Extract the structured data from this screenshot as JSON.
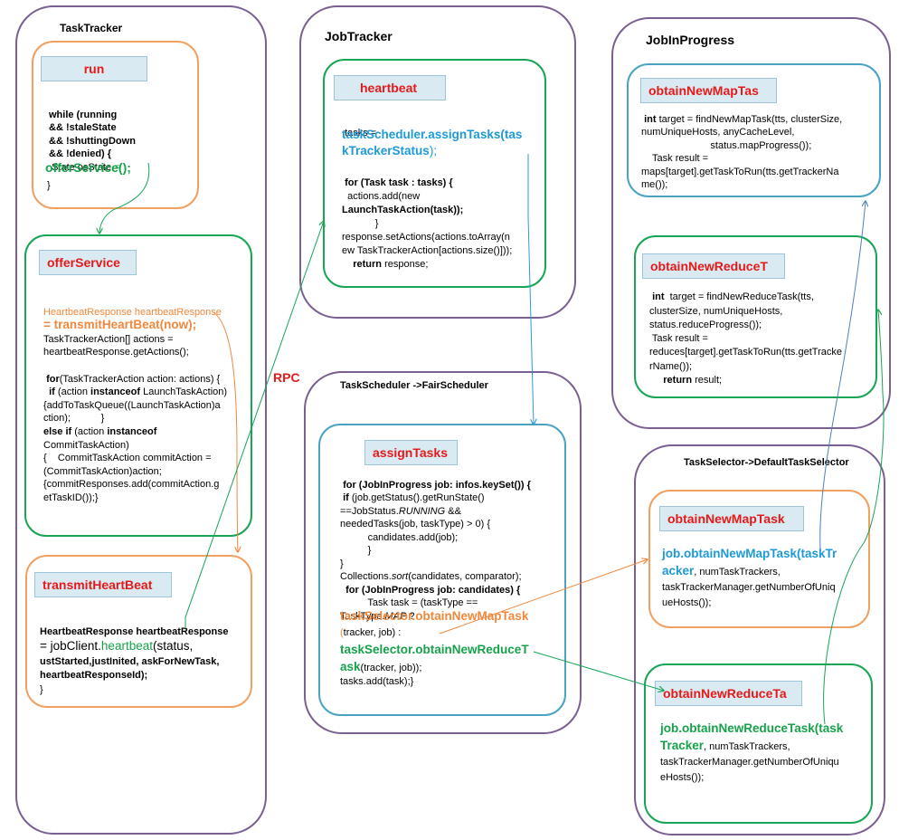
{
  "groups": {
    "tasktracker": "TaskTracker",
    "jobtracker": "JobTracker",
    "jobinprogress": "JobInProgress",
    "taskscheduler": "TaskScheduler  ->FairScheduler",
    "taskselector": "TaskSelector->DefaultTaskSelector"
  },
  "boxes": {
    "run": {
      "label": "run",
      "lines": [
        "while (running",
        "&& !staleState",
        "&& !shuttingDown",
        "&& !denied) {",
        "State osState",
        "=",
        "offerService();",
        "}"
      ]
    },
    "offerService": {
      "label": "offerService",
      "lines": [
        "HeartbeatResponse heartbeatResponse",
        "= transmitHeartBeat(now);",
        "TaskTrackerAction[] actions =",
        "heartbeatResponse.getActions();",
        "for",
        "(TaskTrackerAction action: actions) {",
        "if",
        "(action",
        "instanceof",
        "LaunchTaskAction)",
        "{addToTaskQueue((LaunchTaskAction)a",
        "ction);           }",
        "else if",
        "(action",
        "instanceof",
        "CommitTaskAction)",
        "{    CommitTaskAction commitAction =",
        "(CommitTaskAction)action;",
        "{commitResponses.add(commitAction.g",
        "etTaskID());}"
      ]
    },
    "transmitHeartBeat": {
      "label": "transmitHeartBeat",
      "lines": [
        "HeartbeatResponse heartbeatResponse",
        "= jobClient.",
        "heartbeat",
        "(status,",
        "ustStarted,justInited, askForNewTask,",
        "heartbeatResponseId);",
        "}"
      ]
    },
    "heartbeat": {
      "label": "heartbeat",
      "lines": [
        "tasks =",
        "taskScheduler.assignTasks(tas",
        "kTrackerStatus",
        ");",
        "for (Task task : tasks) {",
        "actions.add(new",
        "LaunchTaskAction(task));",
        "}",
        "response.setActions(actions.toArray(n",
        "ew TaskTrackerAction[actions.size()]));",
        "return",
        "response;"
      ]
    },
    "assignTasks": {
      "label": "assignTasks",
      "lines": [
        "for (JobInProgress job: infos.keySet()) {",
        "if",
        "(job.getStatus().getRunState()",
        "==JobStatus.",
        "RUNNING",
        "&&",
        "neededTasks(job, taskType) > 0) {",
        "candidates.add(job);",
        "}",
        "}",
        "Collections.",
        "sort",
        "(candidates, comparator);",
        "for (JobInProgress job: candidates) {",
        "Task task = (taskType ==",
        "TaskType.",
        "MAP",
        " ?",
        "taskSelector.obtainNewMapTask",
        "(",
        "tracker, job) :",
        "taskSelector.obtainNewReduceT",
        "ask",
        "(tracker, job));",
        "tasks.add(task);}"
      ]
    },
    "obtainNewMapTaskJIP": {
      "label": "obtainNewMapTas",
      "lines": [
        "int",
        " target = findNewMapTask(tts, clusterSize,",
        "numUniqueHosts, anyCacheLevel,",
        "status.mapProgress());",
        "Task result =",
        "maps[target].getTaskToRun(tts.getTrackerNa",
        "me());"
      ]
    },
    "obtainNewReduceTaskJIP": {
      "label": "obtainNewReduceT",
      "lines": [
        "int",
        "  target = findNewReduceTask(tts,",
        "clusterSize, numUniqueHosts,",
        "status.reduceProgress());",
        "Task result =",
        "reduces[target].getTaskToRun(tts.getTracke",
        "rName());",
        "return",
        " result;"
      ]
    },
    "obtainNewMapTaskSel": {
      "label": "obtainNewMapTask",
      "lines": [
        "job.obtainNewMapTask(taskTr",
        "acker",
        ", numTaskTrackers,",
        "taskTrackerManager.getNumberOfUniq",
        "ueHosts());"
      ]
    },
    "obtainNewReduceTaskSel": {
      "label": "obtainNewReduceTa",
      "lines": [
        "job.obtainNewReduceTask(task",
        "Tracker",
        ", numTaskTrackers,",
        "taskTrackerManager.getNumberOfUniqu",
        "eHosts());"
      ]
    }
  },
  "rpc_label": "RPC",
  "colors": {
    "group_border": "#7a5f91",
    "orange": "#f0a060",
    "green": "#17a556",
    "teal": "#4aa3c3",
    "blue_arrow": "#4f81bd",
    "label_bg": "#daeaf3",
    "label_text": "#e61919"
  }
}
